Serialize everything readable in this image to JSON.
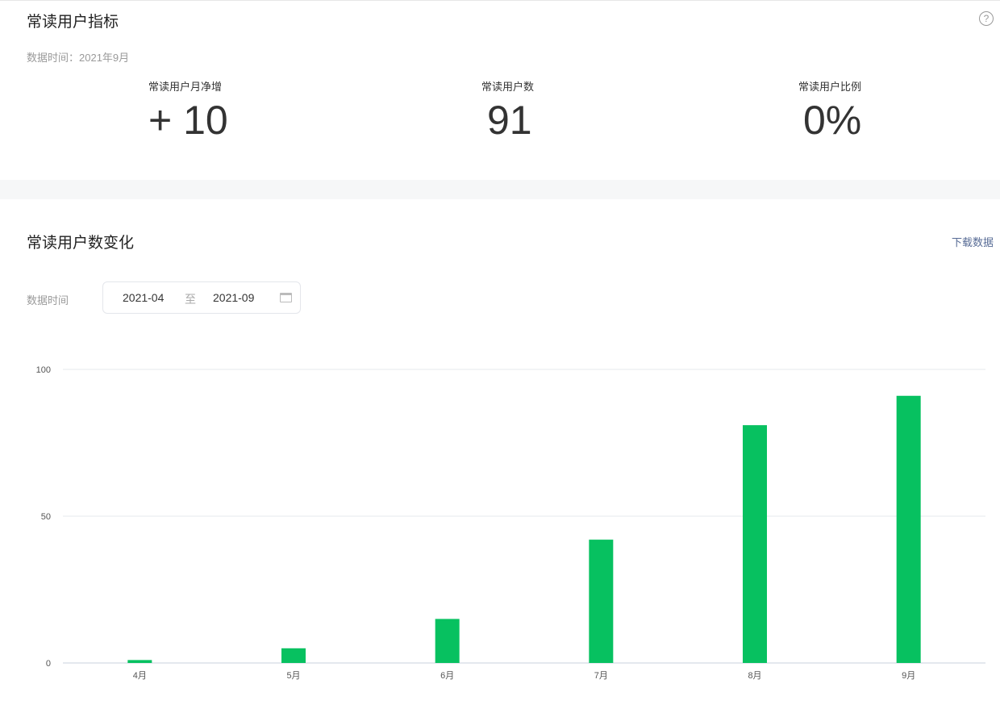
{
  "metrics": {
    "title": "常读用户指标",
    "data_time": "数据时间：2021年9月",
    "help_icon": "?",
    "stats": [
      {
        "label": "常读用户月净增",
        "value": "+ 10"
      },
      {
        "label": "常读用户数",
        "value": "91"
      },
      {
        "label": "常读用户比例",
        "value": "0%"
      }
    ]
  },
  "trend": {
    "title": "常读用户数变化",
    "download": "下载数据",
    "date_label": "数据时间",
    "start": "2021-04",
    "sep": "至",
    "end": "2021-09"
  },
  "chart_data": {
    "type": "bar",
    "categories": [
      "4月",
      "5月",
      "6月",
      "7月",
      "8月",
      "9月"
    ],
    "values": [
      1,
      5,
      15,
      42,
      81,
      91
    ],
    "ylim": [
      0,
      100
    ],
    "yticks": [
      0,
      50,
      100
    ],
    "ytick_labels": [
      "0",
      "50",
      "100"
    ],
    "color": "#07c160",
    "grid": true,
    "title": "",
    "xlabel": "",
    "ylabel": ""
  }
}
